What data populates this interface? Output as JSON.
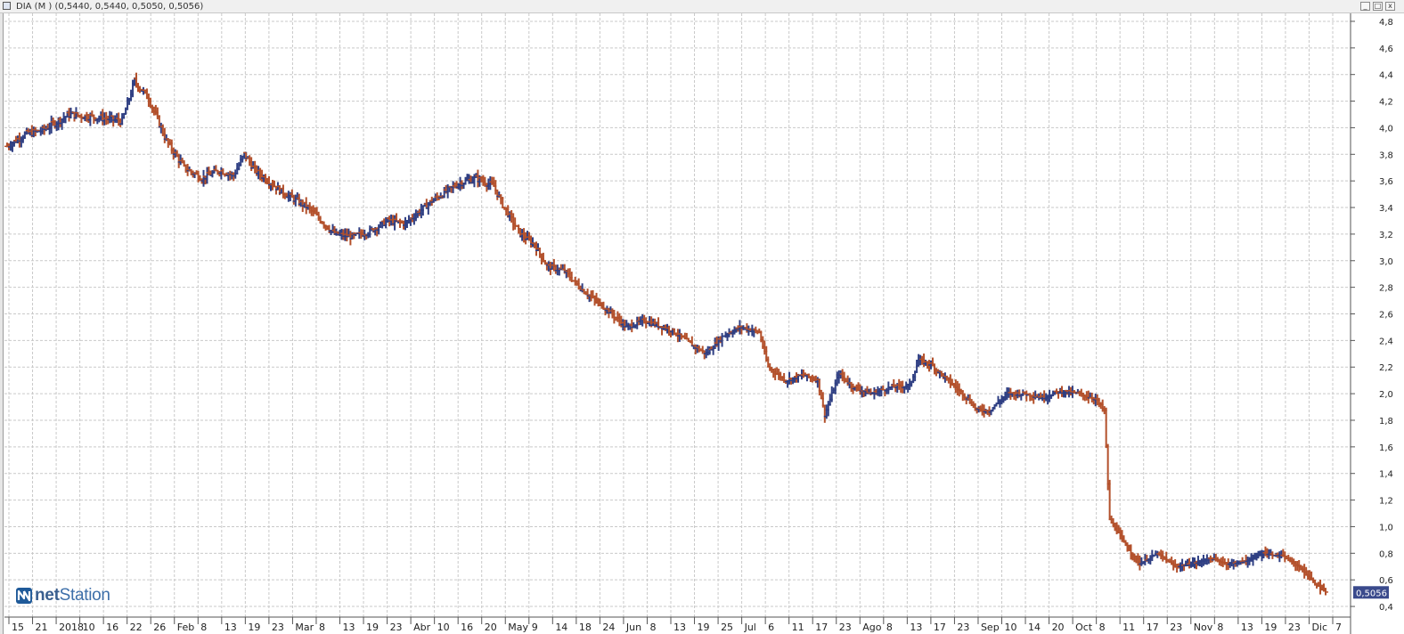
{
  "window": {
    "caption": "DIA (M ) (0,5440, 0,5440, 0,5050, 0,5056)",
    "buttons": [
      "_",
      "□",
      "x"
    ]
  },
  "logo": {
    "text_bold": "net",
    "text": "Station"
  },
  "colors": {
    "up": "#2f3f83",
    "down": "#b3502b",
    "grid": "#c9c9c9",
    "price_tag_bg": "#3a4a8c"
  },
  "chart_data": {
    "type": "ohlc",
    "symbol": "DIA",
    "last_price_label": "0,5056",
    "ylim": [
      0.32,
      4.86
    ],
    "yticks": [
      "0,4",
      "0,6",
      "0,8",
      "1,0",
      "1,2",
      "1,4",
      "1,6",
      "1,8",
      "2,0",
      "2,2",
      "2,4",
      "2,6",
      "2,8",
      "3,0",
      "3,2",
      "3,4",
      "3,6",
      "3,8",
      "4,0",
      "4,2",
      "4,4",
      "4,6",
      "4,8"
    ],
    "grid": true,
    "xticks": [
      "15",
      "21",
      "2018",
      "10",
      "16",
      "22",
      "26",
      "Feb",
      "8",
      "13",
      "19",
      "23",
      "Mar",
      "8",
      "13",
      "19",
      "23",
      "Abr",
      "10",
      "16",
      "20",
      "May",
      "9",
      "14",
      "18",
      "24",
      "Jun",
      "8",
      "13",
      "19",
      "25",
      "Jul",
      "6",
      "11",
      "17",
      "23",
      "Ago",
      "8",
      "13",
      "17",
      "23",
      "Sep",
      "10",
      "14",
      "20",
      "Oct",
      "8",
      "11",
      "17",
      "23",
      "Nov",
      "8",
      "13",
      "19",
      "23",
      "Dic",
      "7"
    ],
    "close_path": [
      [
        0,
        3.86
      ],
      [
        10,
        3.95
      ],
      [
        20,
        3.98
      ],
      [
        35,
        4.1
      ],
      [
        50,
        4.08
      ],
      [
        65,
        4.05
      ],
      [
        72,
        4.35
      ],
      [
        80,
        4.22
      ],
      [
        90,
        3.9
      ],
      [
        100,
        3.7
      ],
      [
        110,
        3.62
      ],
      [
        120,
        3.68
      ],
      [
        128,
        3.64
      ],
      [
        134,
        3.8
      ],
      [
        140,
        3.68
      ],
      [
        155,
        3.52
      ],
      [
        170,
        3.4
      ],
      [
        185,
        3.2
      ],
      [
        195,
        3.18
      ],
      [
        205,
        3.22
      ],
      [
        215,
        3.3
      ],
      [
        225,
        3.28
      ],
      [
        240,
        3.45
      ],
      [
        255,
        3.58
      ],
      [
        265,
        3.62
      ],
      [
        275,
        3.56
      ],
      [
        280,
        3.42
      ],
      [
        290,
        3.2
      ],
      [
        298,
        3.12
      ],
      [
        305,
        2.96
      ],
      [
        315,
        2.92
      ],
      [
        325,
        2.78
      ],
      [
        340,
        2.62
      ],
      [
        350,
        2.5
      ],
      [
        360,
        2.55
      ],
      [
        375,
        2.48
      ],
      [
        390,
        2.34
      ],
      [
        395,
        2.3
      ],
      [
        405,
        2.44
      ],
      [
        415,
        2.5
      ],
      [
        425,
        2.46
      ],
      [
        430,
        2.2
      ],
      [
        440,
        2.1
      ],
      [
        450,
        2.14
      ],
      [
        458,
        2.1
      ],
      [
        462,
        1.84
      ],
      [
        470,
        2.15
      ],
      [
        478,
        2.05
      ],
      [
        488,
        2.0
      ],
      [
        500,
        2.05
      ],
      [
        510,
        2.06
      ],
      [
        515,
        2.25
      ],
      [
        522,
        2.22
      ],
      [
        530,
        2.12
      ],
      [
        540,
        2.0
      ],
      [
        548,
        1.88
      ],
      [
        555,
        1.87
      ],
      [
        565,
        2.0
      ],
      [
        575,
        2.0
      ],
      [
        585,
        1.97
      ],
      [
        595,
        2.02
      ],
      [
        605,
        2.0
      ],
      [
        615,
        1.96
      ],
      [
        620,
        1.87
      ],
      [
        623,
        1.05
      ],
      [
        628,
        0.95
      ],
      [
        632,
        0.86
      ],
      [
        640,
        0.72
      ],
      [
        650,
        0.8
      ],
      [
        660,
        0.7
      ],
      [
        670,
        0.72
      ],
      [
        680,
        0.76
      ],
      [
        690,
        0.72
      ],
      [
        700,
        0.74
      ],
      [
        710,
        0.8
      ],
      [
        720,
        0.78
      ],
      [
        730,
        0.7
      ],
      [
        740,
        0.56
      ],
      [
        745,
        0.5056
      ]
    ]
  }
}
